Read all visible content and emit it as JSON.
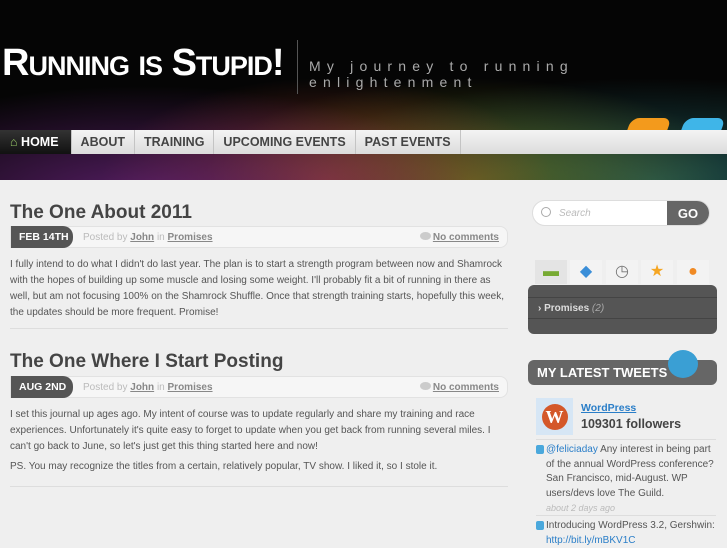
{
  "site": {
    "title": "Running is Stupid!",
    "tagline": "My journey to running enlightenment"
  },
  "nav": [
    "HOME",
    "ABOUT",
    "TRAINING",
    "UPCOMING EVENTS",
    "PAST EVENTS"
  ],
  "posts": [
    {
      "title": "The One About 2011",
      "date": "FEB 14TH",
      "posted_by": "Posted by",
      "author": "John",
      "in": "in",
      "category": "Promises",
      "comments": "No comments",
      "paragraphs": [
        "I fully intend to do what I didn't do last year.  The plan is to start a strength program between now and Shamrock with the hopes of building up some muscle and losing some weight.  I'll probably fit a bit of running in there as well, but am not focusing 100% on the Shamrock Shuffle.  Once that strength training starts, hopefully this week, the updates should be more frequent.  Promise!"
      ]
    },
    {
      "title": "The One Where I Start Posting",
      "date": "AUG 2ND",
      "posted_by": "Posted by",
      "author": "John",
      "in": "in",
      "category": "Promises",
      "comments": "No comments",
      "paragraphs": [
        "I set this journal up ages ago.  My intent of course was to update regularly and share my training and race experiences.  Unfortunately it's quite easy to forget to update when you get back from running several miles.  I can't go back to June, so let's just get this thing started here and now!",
        "PS.  You may recognize the titles from a certain, relatively popular, TV show.  I liked it, so I stole it."
      ]
    }
  ],
  "search": {
    "placeholder": "Search",
    "button": "GO"
  },
  "categories": {
    "tabs": [
      "folder-icon",
      "tag-icon",
      "clock-icon",
      "star-icon",
      "comment-icon"
    ],
    "items": [
      {
        "name": "Promises",
        "count": "(2)"
      }
    ]
  },
  "tweets": {
    "heading": "MY LATEST TWEETS",
    "account": "WordPress",
    "followers": "109301 followers",
    "items": [
      {
        "mention": "@feliciaday",
        "text": " Any interest in being part of the annual WordPress conference? San Francisco, mid-August. WP users/devs love The Guild.",
        "time": "about 2 days ago"
      },
      {
        "text": "Introducing WordPress 3.2, Gershwin: ",
        "link": "http://bit.ly/mBKV1C"
      }
    ]
  }
}
